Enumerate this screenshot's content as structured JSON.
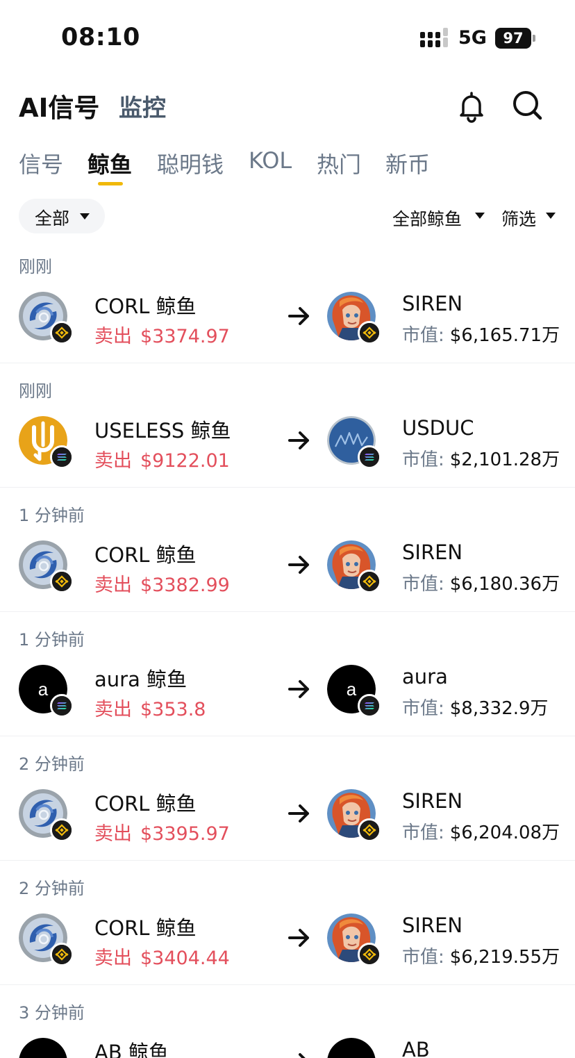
{
  "status_bar": {
    "time": "08:10",
    "network": "5G",
    "battery": "97"
  },
  "header": {
    "title": "AI信号",
    "subtitle": "监控"
  },
  "tabs": [
    {
      "label": "信号",
      "active": false
    },
    {
      "label": "鲸鱼",
      "active": true
    },
    {
      "label": "聪明钱",
      "active": false
    },
    {
      "label": "KOL",
      "active": false
    },
    {
      "label": "热门",
      "active": false
    },
    {
      "label": "新币",
      "active": false
    }
  ],
  "filters": {
    "scope": "全部",
    "whale_filter": "全部鲸鱼",
    "filter": "筛选"
  },
  "colors": {
    "accent": "#f0b90b",
    "sell": "#e34f5c",
    "muted": "#6b7889"
  },
  "mcap_label": "市值:",
  "entries": [
    {
      "time": "刚刚",
      "whale": "CORL 鲸鱼",
      "action": "卖出",
      "amount": "$3374.97",
      "token": "SIREN",
      "mcap": "$6,165.71万",
      "whale_icon": "corl-logo",
      "token_icon": "siren-logo",
      "chain": "bnb-chain-icon"
    },
    {
      "time": "刚刚",
      "whale": "USELESS 鲸鱼",
      "action": "卖出",
      "amount": "$9122.01",
      "token": "USDUC",
      "mcap": "$2,101.28万",
      "whale_icon": "useless-logo",
      "token_icon": "usduc-logo",
      "chain": "solana-chain-icon"
    },
    {
      "time": "1 分钟前",
      "whale": "CORL 鲸鱼",
      "action": "卖出",
      "amount": "$3382.99",
      "token": "SIREN",
      "mcap": "$6,180.36万",
      "whale_icon": "corl-logo",
      "token_icon": "siren-logo",
      "chain": "bnb-chain-icon"
    },
    {
      "time": "1 分钟前",
      "whale": "aura 鲸鱼",
      "action": "卖出",
      "amount": "$353.8",
      "token": "aura",
      "mcap": "$8,332.9万",
      "whale_icon": "aura-logo",
      "token_icon": "aura-logo",
      "chain": "solana-chain-icon",
      "avatar_letter": "a"
    },
    {
      "time": "2 分钟前",
      "whale": "CORL 鲸鱼",
      "action": "卖出",
      "amount": "$3395.97",
      "token": "SIREN",
      "mcap": "$6,204.08万",
      "whale_icon": "corl-logo",
      "token_icon": "siren-logo",
      "chain": "bnb-chain-icon"
    },
    {
      "time": "2 分钟前",
      "whale": "CORL 鲸鱼",
      "action": "卖出",
      "amount": "$3404.44",
      "token": "SIREN",
      "mcap": "$6,219.55万",
      "whale_icon": "corl-logo",
      "token_icon": "siren-logo",
      "chain": "bnb-chain-icon"
    },
    {
      "time": "3 分钟前",
      "whale": "AB 鲸鱼",
      "action": "",
      "amount": "",
      "token": "AB",
      "mcap": "",
      "whale_icon": "ab-logo",
      "token_icon": "ab-logo",
      "chain": ""
    }
  ]
}
